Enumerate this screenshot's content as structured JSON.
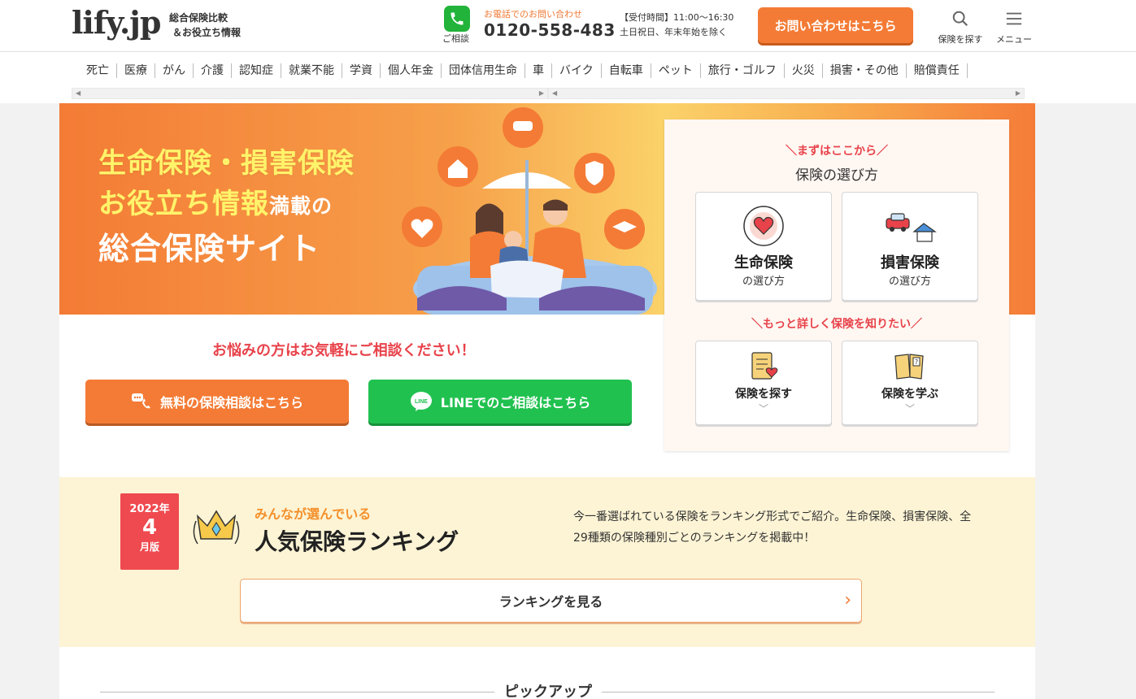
{
  "header": {
    "logo": "lify.jp",
    "logo_reg": "®",
    "tagline_1": "総合保険比較",
    "tagline_2": "＆お役立ち情報",
    "phone_caption": "ご相談",
    "phone_top": "お電話でのお問い合わせ",
    "phone_number": "0120-558-483",
    "hours_1": "【受付時間】11:00～16:30",
    "hours_2": "土日祝日、年末年始を除く",
    "contact_button": "お問い合わせはこちら",
    "search_label": "保険を探す",
    "menu_label": "メニュー"
  },
  "categories": [
    "死亡",
    "医療",
    "がん",
    "介護",
    "認知症",
    "就業不能",
    "学資",
    "個人年金",
    "団体信用生命",
    "車",
    "バイク",
    "自転車",
    "ペット",
    "旅行・ゴルフ",
    "火災",
    "損害・その他",
    "賠償責任"
  ],
  "hero": {
    "line1": "生命保険・損害保険",
    "line2_main": "お役立ち情報",
    "line2_small": "満載の",
    "line3": "総合保険サイト"
  },
  "consult": {
    "message": "お悩みの方はお気軽にご相談ください！",
    "free_button": "無料の保険相談はこちら",
    "line_button": "LINEでのご相談はこちら",
    "line_logo": "LINE"
  },
  "panel": {
    "head1": "＼まずはここから／",
    "title": "保険の選び方",
    "card1_title": "生命保険",
    "card1_sub": "の選び方",
    "card2_title": "損害保険",
    "card2_sub": "の選び方",
    "head2": "＼もっと詳しく保険を知りたい／",
    "card3_title": "保険を探す",
    "card4_title": "保険を学ぶ"
  },
  "ranking": {
    "badge_year": "2022年",
    "badge_month": "4",
    "badge_edition": "月版",
    "small": "みんなが選んでいる",
    "big": "人気保険ランキング",
    "description": "今一番選ばれている保険をランキング形式でご紹介。生命保険、損害保険、全29種類の保険種別ごとのランキングを掲載中！",
    "button": "ランキングを見る"
  },
  "pickup": "ピックアップ",
  "colors": {
    "accent_orange": "#f47b35",
    "line_green": "#21c150",
    "alert_red": "#e8424a",
    "hero_yellow": "#fff36a"
  }
}
